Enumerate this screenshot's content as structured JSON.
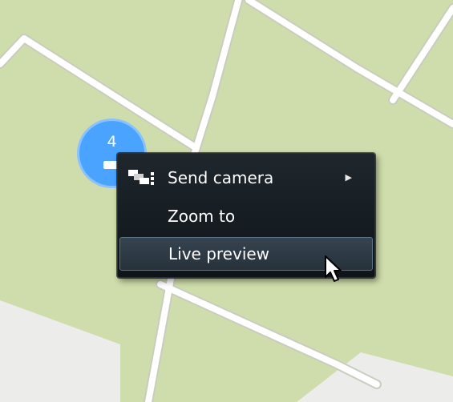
{
  "map": {
    "background_color": "#cfdcab",
    "road_color": "#ffffff"
  },
  "cluster": {
    "count": "4",
    "color": "#4aa3ff",
    "icon": "camera-icon"
  },
  "context_menu": {
    "items": [
      {
        "label": "Send camera",
        "icon": "send-camera-icon",
        "has_submenu": true
      },
      {
        "label": "Zoom to",
        "icon": "",
        "has_submenu": false
      },
      {
        "label": "Live preview",
        "icon": "",
        "has_submenu": false,
        "hovered": true
      }
    ],
    "submenu_arrow": "▶"
  },
  "cursor": "arrow-cursor"
}
